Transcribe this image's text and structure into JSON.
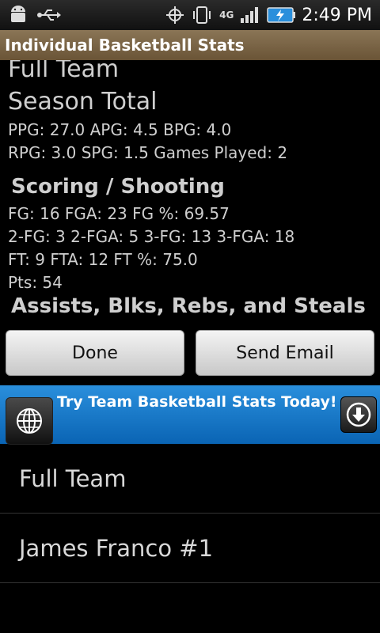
{
  "status_bar": {
    "time": "2:49 PM",
    "network": "4G",
    "icons": [
      "android-icon",
      "usb-icon",
      "gps-icon",
      "vibrate-icon",
      "4g-icon",
      "signal-icon",
      "battery-charging-icon"
    ]
  },
  "title_bar": {
    "title": "Individual Basketball Stats"
  },
  "stats": {
    "team": "Full Team",
    "period": "Season Total",
    "line1": "PPG: 27.0  APG: 4.5  BPG: 4.0",
    "line2": "RPG: 3.0  SPG: 1.5  Games Played: 2",
    "scoring_header": "Scoring / Shooting",
    "fg_line": "FG: 16  FGA: 23  FG %: 69.57",
    "fg2_line": "2-FG: 3  2-FGA: 5  3-FG: 13  3-FGA: 18",
    "ft_line": "FT: 9  FTA: 12  FT %: 75.0",
    "pts_line": "Pts: 54",
    "misc_header": "Assists, Blks, Rebs, and Steals"
  },
  "buttons": {
    "done": "Done",
    "send_email": "Send Email"
  },
  "ad": {
    "text": "Try Team Basketball Stats Today!"
  },
  "list": {
    "items": [
      {
        "label": "Full Team"
      },
      {
        "label": "James Franco #1"
      }
    ]
  }
}
